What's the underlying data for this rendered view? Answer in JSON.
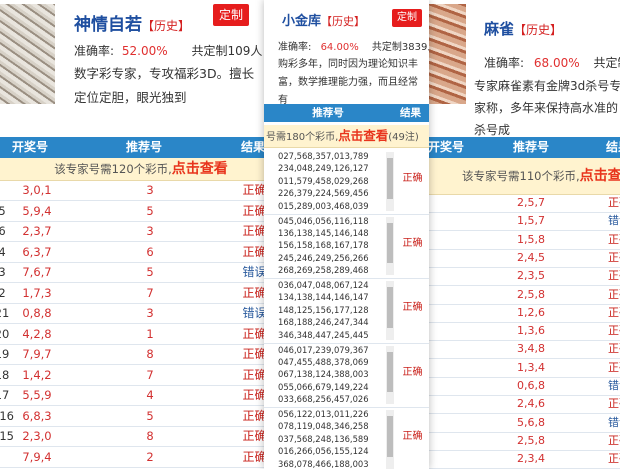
{
  "experts": [
    {
      "name": "神情自若",
      "tag": "【历史】",
      "dz": "定制",
      "acc_label": "准确率:",
      "acc": "52.00%",
      "cnt": "共定制109人",
      "desc": "数字彩专家，专攻福彩3D。擅长定位定胆，眼光独到"
    },
    {
      "name": "小金库",
      "tag": "【历史】",
      "dz": "定制",
      "acc_label": "准确率:",
      "acc": "64.00%",
      "cnt": "共定制3839人",
      "desc": "购彩多年，同时因为理论知识丰富，数学推理能力强，而且经常有"
    },
    {
      "name": "麻雀",
      "tag": "【历史】",
      "dz": "定制",
      "acc_label": "准确率:",
      "acc": "68.00%",
      "cnt": "共定制",
      "desc": "专家麻雀素有金牌3d杀号专家称，多年来保持高水准的杀号成"
    }
  ],
  "heads": {
    "kj": "开奖号",
    "tj": "推荐号",
    "jg": "结果"
  },
  "notices": {
    "left": {
      "pre": "该专家号需120个彩币,",
      "link": "点击查看"
    },
    "mid": {
      "pre": "号需180个彩币,",
      "link": "点击查看",
      "suf": "(49注)"
    },
    "right": {
      "pre": "该专家号需110个彩币,",
      "link": "点击查看"
    }
  },
  "left_rows": [
    {
      "kj": "3,0,1",
      "tj": "3",
      "res": "正确",
      "s": "ok"
    },
    {
      "kj": "5,9,4",
      "tj": "5",
      "res": "正确",
      "s": "ok"
    },
    {
      "kj": "2,3,7",
      "tj": "3",
      "res": "正确",
      "s": "ok"
    },
    {
      "kj": "6,3,7",
      "tj": "6",
      "res": "正确",
      "s": "ok"
    },
    {
      "kj": "7,6,7",
      "tj": "5",
      "res": "错误",
      "s": "bad"
    },
    {
      "kj": "1,7,3",
      "tj": "7",
      "res": "正确",
      "s": "ok"
    },
    {
      "kj": "0,8,8",
      "tj": "3",
      "res": "错误",
      "s": "bad"
    },
    {
      "kj": "4,2,8",
      "tj": "1",
      "res": "正确",
      "s": "ok"
    },
    {
      "kj": "7,9,7",
      "tj": "8",
      "res": "正确",
      "s": "ok"
    },
    {
      "kj": "1,4,2",
      "tj": "7",
      "res": "正确",
      "s": "ok"
    },
    {
      "kj": "5,5,9",
      "tj": "4",
      "res": "正确",
      "s": "ok"
    },
    {
      "kj": "6,8,3",
      "tj": "5",
      "res": "正确",
      "s": "ok"
    },
    {
      "kj": "2,3,0",
      "tj": "8",
      "res": "正确",
      "s": "ok"
    },
    {
      "kj": "7,9,4",
      "tj": "2",
      "res": "正确",
      "s": "ok"
    }
  ],
  "left_ids": [
    "",
    "5",
    "6",
    "4",
    "3",
    "2",
    "21",
    "20",
    "19",
    "18",
    "17",
    "016",
    "015",
    ""
  ],
  "mid_groups": [
    {
      "lines": [
        "027,568,357,013,789",
        "234,048,249,126,127",
        "011,579,458,029,268",
        "226,379,224,569,456",
        "015,289,003,468,039"
      ],
      "res": "正确",
      "s": "ok"
    },
    {
      "lines": [
        "045,046,056,116,118",
        "136,138,145,146,148",
        "156,158,168,167,178",
        "245,246,249,256,266",
        "268,269,258,289,468"
      ],
      "res": "正确",
      "s": "ok"
    },
    {
      "lines": [
        "036,047,048,067,124",
        "134,138,144,146,147",
        "148,125,156,177,128",
        "168,188,246,247,344",
        "346,348,447,245,445"
      ],
      "res": "正确",
      "s": "ok"
    },
    {
      "lines": [
        "046,017,239,079,367",
        "047,455,488,378,069",
        "067,138,124,388,003",
        "055,066,679,149,224",
        "033,668,256,457,026"
      ],
      "res": "正确",
      "s": "ok"
    },
    {
      "lines": [
        "056,122,013,011,226",
        "078,119,048,346,258",
        "037,568,248,136,589",
        "016,266,056,155,124",
        "368,078,466,188,003"
      ],
      "res": "正确",
      "s": "ok"
    }
  ],
  "right_rows": [
    {
      "tj": "2,5,7",
      "res": "正确",
      "s": "ok"
    },
    {
      "tj": "1,5,7",
      "res": "错误",
      "s": "bad"
    },
    {
      "tj": "1,5,8",
      "res": "正确",
      "s": "ok"
    },
    {
      "tj": "2,4,5",
      "res": "正确",
      "s": "ok"
    },
    {
      "tj": "2,3,5",
      "res": "正确",
      "s": "ok"
    },
    {
      "tj": "2,5,8",
      "res": "正确",
      "s": "ok"
    },
    {
      "tj": "1,2,6",
      "res": "正确",
      "s": "ok"
    },
    {
      "tj": "1,3,6",
      "res": "正确",
      "s": "ok"
    },
    {
      "tj": "3,4,8",
      "res": "正确",
      "s": "ok"
    },
    {
      "tj": "1,3,4",
      "res": "正确",
      "s": "ok"
    },
    {
      "tj": "0,6,8",
      "res": "错误",
      "s": "bad"
    },
    {
      "tj": "2,4,6",
      "res": "正确",
      "s": "ok"
    },
    {
      "tj": "5,6,8",
      "res": "错误",
      "s": "bad"
    },
    {
      "tj": "2,5,8",
      "res": "正确",
      "s": "ok"
    },
    {
      "tj": "2,3,4",
      "res": "正确",
      "s": "ok"
    }
  ]
}
